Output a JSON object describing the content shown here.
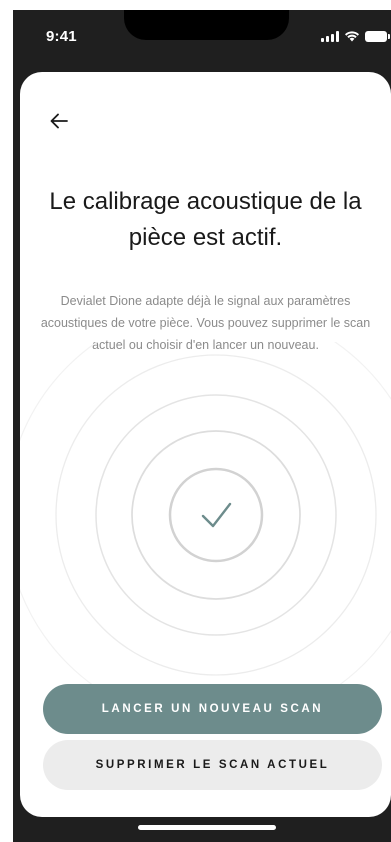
{
  "status_bar": {
    "time": "9:41",
    "icons": [
      "signal-icon",
      "wifi-icon",
      "battery-icon"
    ]
  },
  "header": {
    "back_icon": "arrow-left-icon"
  },
  "main": {
    "title": "Le calibrage acoustique de la pièce est actif.",
    "description": "Devialet Dione adapte déjà le signal aux paramètres acoustiques de votre pièce. Vous pouvez supprimer le scan actuel ou choisir d'en lancer un nouveau.",
    "status_icon": "check-icon"
  },
  "actions": {
    "primary_label": "LANCER UN NOUVEAU SCAN",
    "secondary_label": "SUPPRIMER LE SCAN ACTUEL"
  },
  "colors": {
    "accent": "#6d8c8c",
    "secondary_button": "#ececec",
    "frame": "#1f1f1f",
    "text_primary": "#1a1a1a",
    "text_secondary": "#8b8b8b"
  }
}
